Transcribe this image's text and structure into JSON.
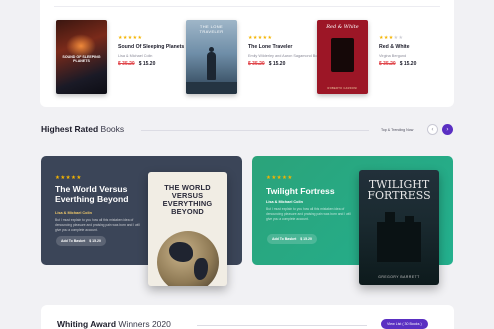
{
  "products": [
    {
      "title": "Sound Of Sleeping Planets",
      "author": "Lisa & Michael Colin",
      "old_price": "$ 35.20",
      "new_price": "$ 15.20",
      "rating": 5,
      "cover_text": "SOUND OF SLEEPING PLANETS"
    },
    {
      "title": "The Lone Traveler",
      "author": "Emily Wilderley and Aaron Sagamond Books",
      "old_price": "$ 35.20",
      "new_price": "$ 15.20",
      "rating": 5,
      "cover_text": "THE LONE TRAVELER"
    },
    {
      "title": "Red & White",
      "author": "Virgina Bergund",
      "old_price": "$ 35.20",
      "new_price": "$ 15.20",
      "rating": 3,
      "cover_text": "Red & White",
      "cover_footer": "ROBERTO CARDONI"
    }
  ],
  "highest_rated": {
    "title_bold": "Highest Rated",
    "title_light": "Books",
    "tabs_label": "Top & Trending Now",
    "prev_icon": "chevron-left-icon",
    "next_icon": "chevron-right-icon"
  },
  "featured": [
    {
      "title": "The World Versus Everthing Beyond",
      "author": "Lisa & Michael Colin",
      "description": "But I must explain to you how all this mistaken idea of denouncing pleasure and praising pain was born and I will give you a complete account.",
      "cart_label": "Add To Basket",
      "price": "$ 15.20",
      "rating": 5,
      "cover_text": "THE WORLD VERSUS EVERYTHING BEYOND"
    },
    {
      "title": "Twilight Fortress",
      "author": "Lisa & Michael Colin",
      "description": "But I must explain to you how all this mistaken idea of denouncing pleasure and praising pain was born and I will give you a complete account.",
      "cart_label": "Add To Basket",
      "price": "$ 15.20",
      "rating": 5,
      "cover_text": "TWILIGHT FORTRESS",
      "cover_footer": "GREGORY BARRETT"
    }
  ],
  "award": {
    "title_bold": "Whiting Award",
    "title_light": "Winners 2020",
    "button_label": "View List ( 30 Books )"
  },
  "colors": {
    "accent": "#5a2fc2",
    "star": "#f4b400",
    "dark_card": "#3b4558",
    "green_card": "#2ba37a"
  }
}
